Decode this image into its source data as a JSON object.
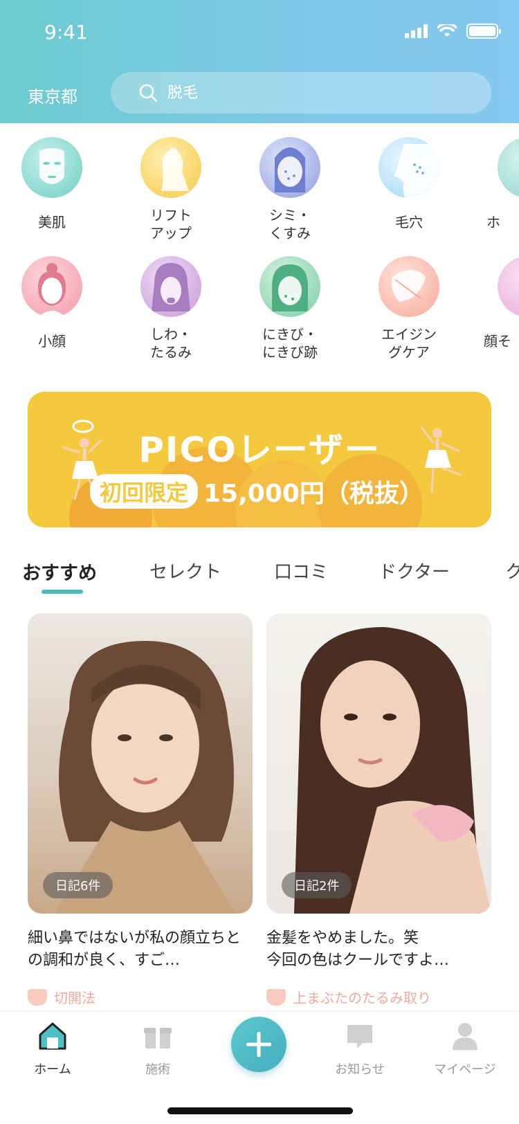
{
  "status": {
    "time": "9:41"
  },
  "header": {
    "location": "東京都",
    "search_placeholder": "脱毛"
  },
  "categories": [
    {
      "label": "美肌",
      "color": "#6fcfc6"
    },
    {
      "label": "リフト\nアップ",
      "color": "#f5c84a"
    },
    {
      "label": "シミ・\nくすみ",
      "color": "#8f9fe0"
    },
    {
      "label": "毛穴",
      "color": "#9fd8f5"
    },
    {
      "label": "ホ",
      "color": "#8fd4cc"
    },
    {
      "label": "小顔",
      "color": "#f29aa8"
    },
    {
      "label": "しわ・\nたるみ",
      "color": "#c79ad8"
    },
    {
      "label": "にきび・\nにきび跡",
      "color": "#7ccda5"
    },
    {
      "label": "エイジン\nグケア",
      "color": "#f7a99a"
    },
    {
      "label": "顔そ",
      "color": "#e8a8d8"
    }
  ],
  "banner": {
    "title": "PICOレーザー",
    "tag": "初回限定",
    "price": "15,000円（税抜）",
    "color": "#f4c93e"
  },
  "tabs": [
    {
      "label": "おすすめ",
      "active": true
    },
    {
      "label": "セレクト",
      "active": false
    },
    {
      "label": "口コミ",
      "active": false
    },
    {
      "label": "ドクター",
      "active": false
    },
    {
      "label": "ク",
      "active": false
    }
  ],
  "cards": [
    {
      "badge": "日記6件",
      "title": "細い鼻ではないが私の顔立ちとの調和が良く、すご…",
      "tag": "切開法"
    },
    {
      "badge": "日記2件",
      "title": "金髪をやめました。笑\n今回の色はクールですよ…",
      "tag": "上まぶたのたるみ取り"
    }
  ],
  "nav": [
    {
      "label": "ホーム",
      "icon": "home-icon",
      "active": true
    },
    {
      "label": "施術",
      "icon": "gift-icon",
      "active": false
    },
    {
      "label": "お知らせ",
      "icon": "chat-bubble-icon",
      "active": false
    },
    {
      "label": "マイページ",
      "icon": "person-icon",
      "active": false
    }
  ],
  "accent_color": "#4cb8c0"
}
